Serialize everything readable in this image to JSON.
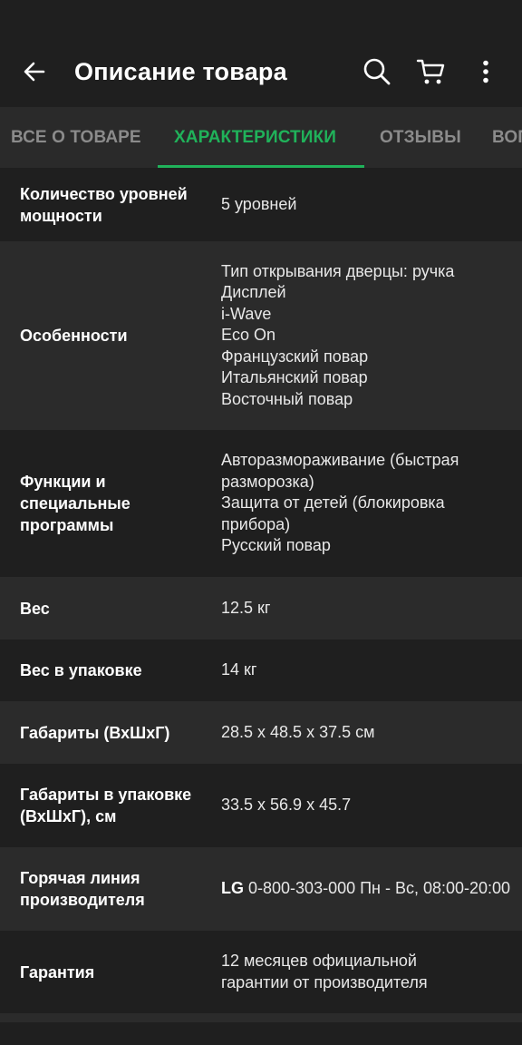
{
  "app_bar": {
    "title": "Описание товара"
  },
  "tabs": [
    {
      "label": "ВСЕ О ТОВАРЕ"
    },
    {
      "label": "ХАРАКТЕРИСТИКИ"
    },
    {
      "label": "ОТЗЫВЫ"
    },
    {
      "label": "ВОПРОСЫ"
    }
  ],
  "specs": {
    "power_levels": {
      "name": "Количество уровней мощности",
      "value": "5 уровней"
    },
    "features": {
      "name": "Особенности",
      "values": [
        "Тип открывания дверцы: ручка",
        "Дисплей",
        "i-Wave",
        "Eco On",
        "Французский повар",
        "Итальянский повар",
        "Восточный повар"
      ]
    },
    "functions": {
      "name": "Функции и специальные программы",
      "values": [
        "Авторазмораживание (быстрая разморозка)",
        "Защита от детей (блокировка прибора)",
        "Русский повар"
      ]
    },
    "weight": {
      "name": "Вес",
      "value": "12.5 кг"
    },
    "weight_packed": {
      "name": "Вес в упаковке",
      "value": "14 кг"
    },
    "dimensions": {
      "name": "Габариты (ВхШхГ)",
      "value": "28.5 x 48.5 x 37.5 см"
    },
    "dimensions_packed": {
      "name": "Габариты в упаковке (ВхШхГ), см",
      "value": "33.5 x 56.9 x 45.7"
    },
    "hotline": {
      "name": "Горячая линия производителя",
      "brand": "LG",
      "value": "0-800-303-000 Пн - Вс, 08:00-20:00"
    },
    "warranty": {
      "name": "Гарантия",
      "value": "12 месяцев официальной гарантии от производителя"
    }
  },
  "icons": {
    "back": "arrow-left-icon",
    "search": "search-icon",
    "cart": "cart-icon",
    "more": "more-vertical-icon"
  },
  "colors": {
    "accent": "#20b25a",
    "background": "#1f1f1f",
    "row_alt": "#2b2b2b",
    "tab_bar": "#2a2a2a",
    "inactive_tab": "#8b8b8b"
  }
}
